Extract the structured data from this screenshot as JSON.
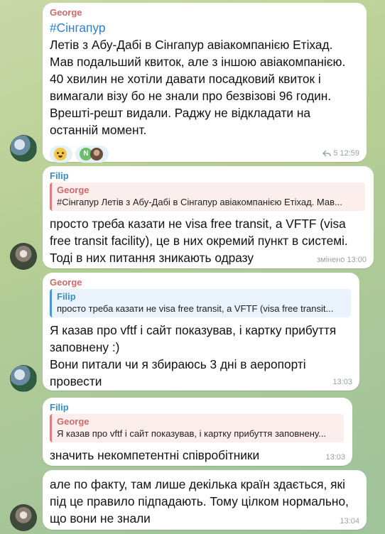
{
  "messages": [
    {
      "sender": "George",
      "hashtag": "#Сінгапур",
      "lines": [
        "Летів з Абу-Дабі в Сінгапур авіакомпанією Етіхад.",
        "Мав подальший квиток, але з іншою авіакомпанією.",
        "40 хвилин не хотіли давати посадковий квиток і",
        "вимагали візу бо не знали про безвізові 96 годин.",
        "Врешті-решт видали. Раджу не відкладати на",
        "останній момент."
      ],
      "reaction_initial": "N",
      "reply_count": "5",
      "time": "12:59"
    },
    {
      "sender": "Filip",
      "reply_sender": "George",
      "reply_text": "#Сінгапур Летів з Абу-Дабі в Сінгапур авіакомпанією Етіхад. Мав...",
      "lines": [
        "просто треба казати не visa free transit, а VFTF (visa",
        "free transit facility), це в них окремий пункт в системі.",
        "Тоді в них питання зникають одразу"
      ],
      "time": "змінено 13:00"
    },
    {
      "sender": "George",
      "reply_sender": "Filip",
      "reply_text": "просто треба казати не visa free transit, а VFTF (visa free transit...",
      "lines": [
        "Я казав про vftf і сайт показував, і картку прибуття",
        "заповнену :)",
        "Вони питали чи я збираюсь 3 дні в аеропорті",
        "провести"
      ],
      "time": "13:03"
    },
    {
      "sender": "Filip",
      "reply_sender": "George",
      "reply_text": "Я казав про vftf і сайт показував, і картку прибуття заповнену...",
      "lines": [
        "значить некомпетентні співробітники"
      ],
      "time": "13:03"
    },
    {
      "lines": [
        "але по факту, там лише декілька країн здається, які",
        "під це правило підпадають. Тому цілком нормально,",
        "що вони не знали"
      ],
      "time": "13:04"
    }
  ]
}
